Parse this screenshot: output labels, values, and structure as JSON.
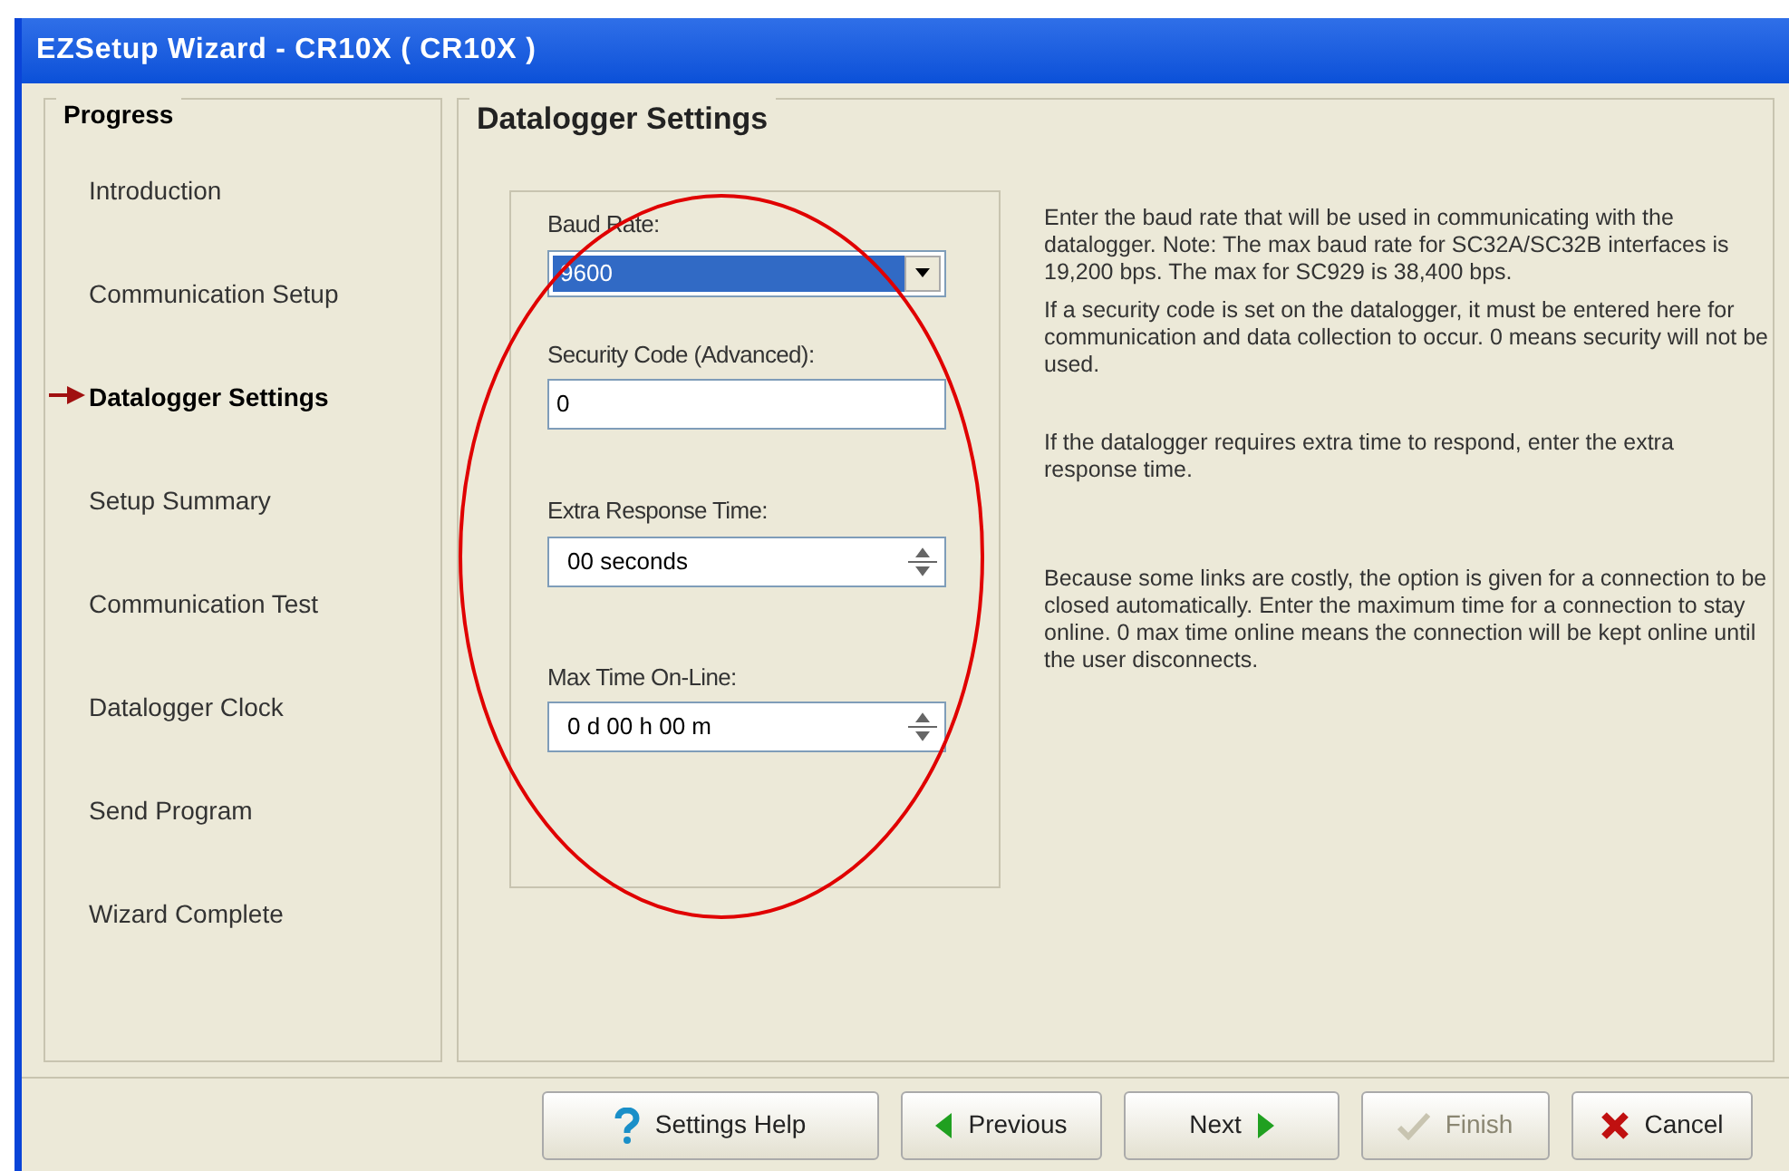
{
  "window": {
    "title": "EZSetup Wizard - CR10X ( CR10X )"
  },
  "progress": {
    "heading": "Progress",
    "items": [
      {
        "label": "Introduction",
        "selected": false
      },
      {
        "label": "Communication Setup",
        "selected": false
      },
      {
        "label": "Datalogger Settings",
        "selected": true
      },
      {
        "label": "Setup Summary",
        "selected": false
      },
      {
        "label": "Communication Test",
        "selected": false
      },
      {
        "label": "Datalogger Clock",
        "selected": false
      },
      {
        "label": "Send Program",
        "selected": false
      },
      {
        "label": "Wizard Complete",
        "selected": false
      }
    ]
  },
  "page": {
    "title": "Datalogger Settings",
    "settings": [
      {
        "kind": "dropdown",
        "label": "Baud Rate:",
        "value": "9600",
        "help": "Enter the baud rate that will be used in communicating with the datalogger.  Note: The max baud rate for SC32A/SC32B interfaces is 19,200 bps.  The max for SC929 is 38,400 bps."
      },
      {
        "kind": "text",
        "label": "Security Code (Advanced):",
        "value": "0",
        "help": "If a security code is set on the datalogger, it must be entered here for communication and data collection to occur.  0 means security will not be used."
      },
      {
        "kind": "spinner",
        "label": "Extra Response Time:",
        "value": "00 seconds",
        "help": "If the datalogger requires extra time to respond, enter the extra response time."
      },
      {
        "kind": "spinner",
        "label": "Max Time On-Line:",
        "value": "0 d 00 h 00 m",
        "help": "Because some links are costly, the option is given for a connection to be closed automatically.  Enter the maximum time for a connection to stay online.  0 max time online means the connection will be kept online until the user disconnects."
      }
    ]
  },
  "buttons": [
    {
      "kind": "help",
      "label": "Settings Help",
      "disabled": false
    },
    {
      "kind": "previous",
      "label": "Previous",
      "disabled": false
    },
    {
      "kind": "next",
      "label": "Next",
      "disabled": false
    },
    {
      "kind": "finish",
      "label": "Finish",
      "disabled": true
    },
    {
      "kind": "cancel",
      "label": "Cancel",
      "disabled": false
    }
  ]
}
